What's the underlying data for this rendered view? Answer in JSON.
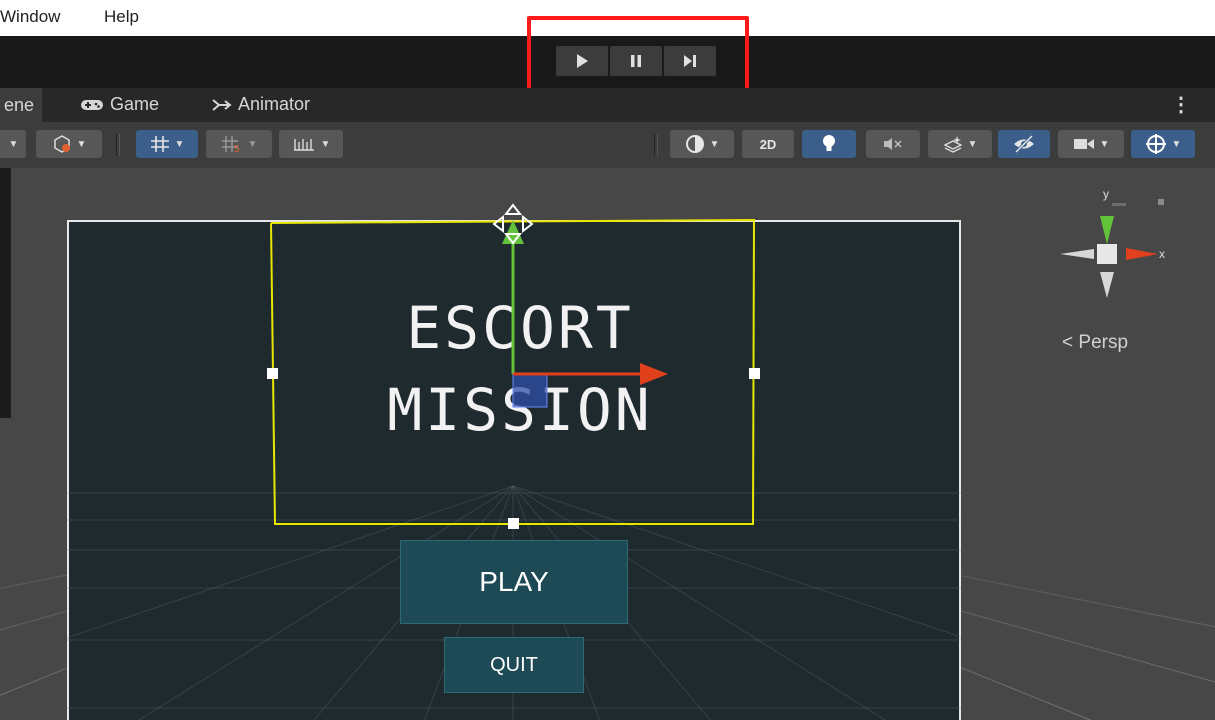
{
  "menu": {
    "items": [
      "Window",
      "Help"
    ]
  },
  "playbar": {
    "play_icon": "play-icon",
    "pause_icon": "pause-icon",
    "step_icon": "step-icon"
  },
  "tabs": {
    "scene_label": "ene",
    "game_label": "Game",
    "animator_label": "Animator"
  },
  "toolbar": {
    "toggle_2d_label": "2D"
  },
  "scene": {
    "title_line1": "ESCORT",
    "title_line2": "MISSION",
    "play_button_label": "PLAY",
    "quit_button_label": "QUIT",
    "persp_label": "Persp",
    "gizmo_y_label": "y",
    "gizmo_x_label": "x"
  },
  "colors": {
    "highlight": "#ff1a1a",
    "selection_rect": "#e6e600",
    "canvas_bg": "#1f2a2f",
    "button_bg": "#1d4a55",
    "axis_x": "#e0401c",
    "axis_y": "#62c23a",
    "toolbar_active": "#3b5e8a"
  }
}
